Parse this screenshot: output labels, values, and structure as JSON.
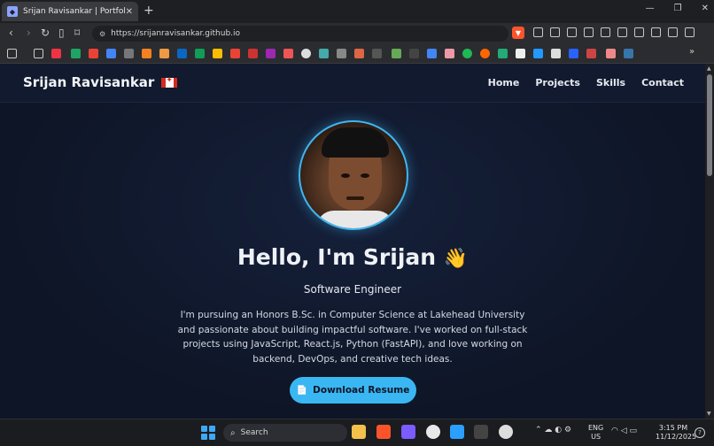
{
  "browser": {
    "tab_title": "Srijan Ravisankar | Portfolio",
    "tab_close": "✕",
    "new_tab": "+",
    "url": "https://srijanravisankar.github.io",
    "window_minimize": "—",
    "window_restore": "❐",
    "window_close": "✕"
  },
  "site": {
    "brand": "Srijan Ravisankar",
    "nav": {
      "home": "Home",
      "projects": "Projects",
      "skills": "Skills",
      "contact": "Contact"
    },
    "hero": {
      "greeting": "Hello, I'm Srijan",
      "wave": "👋",
      "role": "Software Engineer",
      "bio": "I'm pursuing an Honors B.Sc. in Computer Science at Lakehead University and passionate about building impactful software. I've worked on full-stack projects using JavaScript, React.js, Python (FastAPI), and love working on backend, DevOps, and creative tech ideas.",
      "resume_icon": "📄",
      "resume_label": "Download Resume"
    }
  },
  "taskbar": {
    "search_placeholder": "Search",
    "lang_top": "ENG",
    "lang_bottom": "US",
    "time": "3:15 PM",
    "date": "11/12/2025"
  },
  "colors": {
    "accent": "#3ab7f3",
    "page_bg": "#0f1524",
    "nav_bg": "#111a2e"
  }
}
